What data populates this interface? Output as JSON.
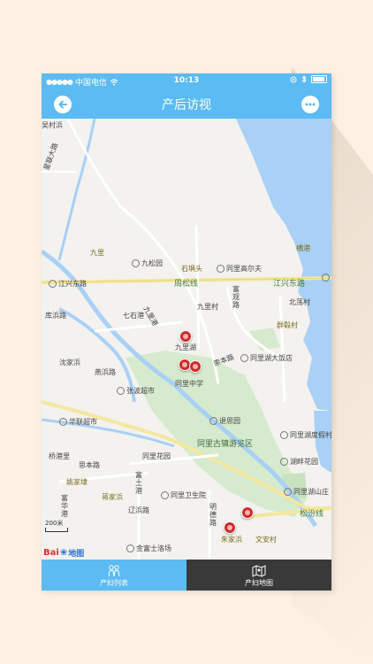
{
  "status_bar": {
    "carrier": "中国电信",
    "time": "10:13"
  },
  "nav": {
    "title": "产后访视"
  },
  "map": {
    "labels": {
      "wucunbang": "吴村浜",
      "xinglianlu": "星联大路",
      "jiuli": "九里",
      "jiusongyuan": "九松园",
      "shijingtou": "石埧头",
      "tonglielfu": "同里高尔夫",
      "jiangxingdonglu_left": "江兴东路",
      "zhousongxian": "周松线",
      "jiangxingdonglu_right": "江兴东路",
      "henggang": "横港",
      "fuguanlu": "富观路",
      "fanbinlu": "库浜路",
      "qishigang": "七石港",
      "jiuligang": "九里港",
      "jiulicun": "九里村",
      "beiluocun": "北荡村",
      "qunmaocun": "群毂村",
      "jiulihu": "九里湖",
      "chongbenlu": "崇本路",
      "tonglihudadian": "同里湖大饭店",
      "shenjiabang": "沈家浜",
      "yanbinlu": "燕浜路",
      "tonglizhongxue": "同里中学",
      "zhangbochaoshi": "张波超市",
      "tuisiyuan": "退思园",
      "hualianchaoshi": "华联超市",
      "tongliguzhen": "同里古镇游览区",
      "tonglihudongshi": "同里湖度假村",
      "qiaoyongli": "桥港里",
      "simaolu": "思本路",
      "tonglihuayuan": "同里花园",
      "huyanyuan": "湖畔花园",
      "yaojialu": "姚家埭",
      "fushigang": "富土港",
      "tongliweishengyuan": "同里卫生院",
      "tonglihushanzhuang": "同里湖山庄",
      "jiangjiabang": "蒋家浜",
      "fuhuagang": "富华港",
      "liaobinlu": "辽浜路",
      "mingdelu": "明德路",
      "songfenxian": "松汾线",
      "zhujiabang": "朱家浜",
      "wenancun": "文安村",
      "jinyuanshi": "金富士洛场"
    },
    "scale_label": "200米",
    "logo_text": "Bai",
    "logo_suffix": "地图"
  },
  "tabs": [
    {
      "label": "产妇列表"
    },
    {
      "label": "产妇地图"
    }
  ],
  "colors": {
    "accent": "#5bbbf2",
    "tab_active": "#393939",
    "pin": "#cf2a2a"
  }
}
